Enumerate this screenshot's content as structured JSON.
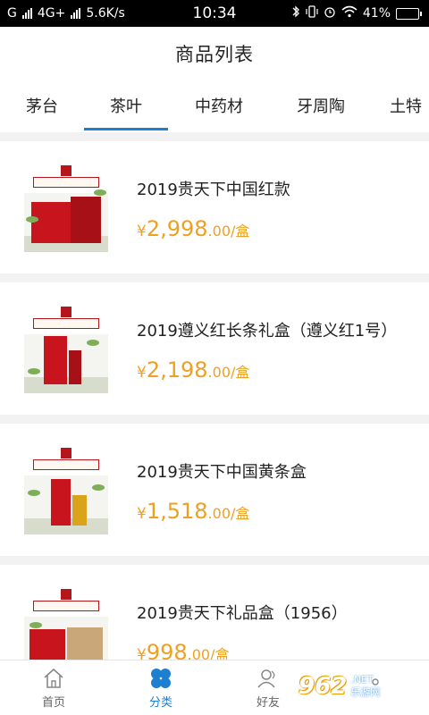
{
  "status_bar": {
    "carrier": "G",
    "network": "4G+",
    "speed": "5.6K/s",
    "time": "10:34",
    "battery": "41%",
    "battery_level": 0.41
  },
  "header": {
    "title": "商品列表"
  },
  "tabs": [
    {
      "label": "茅台",
      "active": false
    },
    {
      "label": "茶叶",
      "active": true
    },
    {
      "label": "中药材",
      "active": false
    },
    {
      "label": "牙周陶",
      "active": false
    },
    {
      "label": "土特",
      "active": false
    }
  ],
  "products": [
    {
      "title": "2019贵天下中国红款",
      "currency": "¥",
      "price_int": "2,998",
      "price_dec": ".00/盒"
    },
    {
      "title": "2019遵义红长条礼盒（遵义红1号）",
      "currency": "¥",
      "price_int": "2,198",
      "price_dec": ".00/盒"
    },
    {
      "title": "2019贵天下中国黄条盒",
      "currency": "¥",
      "price_int": "1,518",
      "price_dec": ".00/盒"
    },
    {
      "title": "2019贵天下礼品盒（1956）",
      "currency": "¥",
      "price_int": "998",
      "price_dec": ".00/盒"
    }
  ],
  "bottom_nav": [
    {
      "label": "首页",
      "icon": "home-icon",
      "active": false
    },
    {
      "label": "分类",
      "icon": "category-icon",
      "active": true
    },
    {
      "label": "好友",
      "icon": "friends-icon",
      "active": false
    }
  ],
  "watermark": {
    "logo": "962",
    "suffix": ".NET",
    "site": "乐游网"
  },
  "colors": {
    "accent": "#1e7fd0",
    "price": "#f0a020",
    "separator": "#f2f2f2"
  }
}
